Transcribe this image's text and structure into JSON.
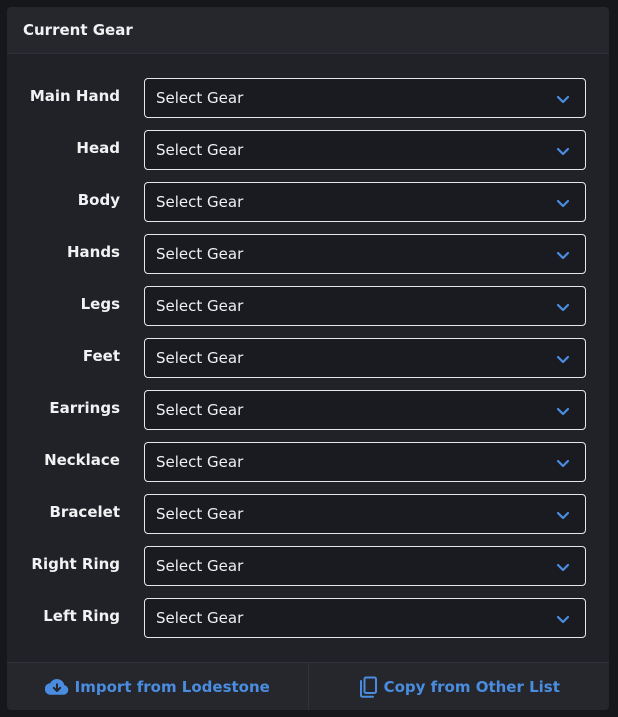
{
  "card": {
    "title": "Current Gear"
  },
  "slots": [
    {
      "label": "Main Hand",
      "value": "Select Gear"
    },
    {
      "label": "Head",
      "value": "Select Gear"
    },
    {
      "label": "Body",
      "value": "Select Gear"
    },
    {
      "label": "Hands",
      "value": "Select Gear"
    },
    {
      "label": "Legs",
      "value": "Select Gear"
    },
    {
      "label": "Feet",
      "value": "Select Gear"
    },
    {
      "label": "Earrings",
      "value": "Select Gear"
    },
    {
      "label": "Necklace",
      "value": "Select Gear"
    },
    {
      "label": "Bracelet",
      "value": "Select Gear"
    },
    {
      "label": "Right Ring",
      "value": "Select Gear"
    },
    {
      "label": "Left Ring",
      "value": "Select Gear"
    }
  ],
  "footer": {
    "import_label": "Import from Lodestone",
    "import_icon": "cloud-download-icon",
    "copy_label": "Copy from Other List",
    "copy_icon": "copy-icon"
  },
  "colors": {
    "accent": "#4a8de0",
    "background": "#15171b",
    "card": "#25272d",
    "text": "#f1f2f4"
  }
}
